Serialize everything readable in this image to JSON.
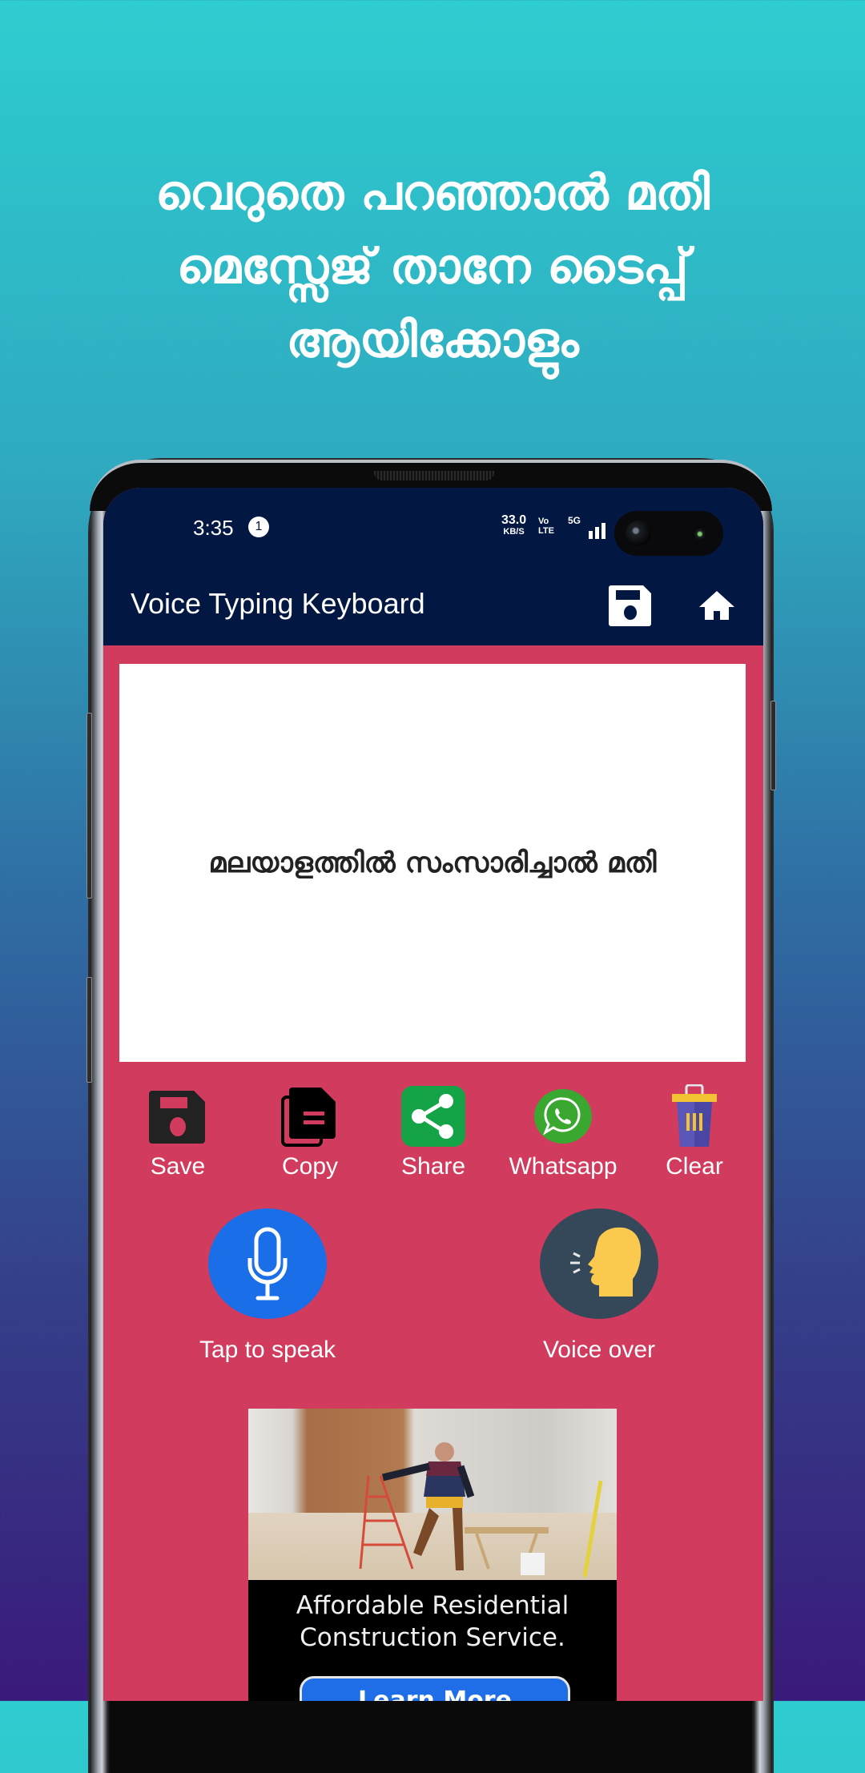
{
  "promo": {
    "lines": [
      "വെറുതെ പറഞ്ഞാൽ മതി",
      "മെസ്സേജ് താനേ ടൈപ്പ്",
      "ആയിക്കോളും"
    ]
  },
  "statusbar": {
    "time": "3:35",
    "notification_count": "1",
    "net_speed_value": "33.0",
    "net_speed_unit": "KB/S",
    "volte_top": "Vo",
    "volte_bottom": "LTE",
    "network_type": "5G",
    "icons": [
      "signal-icon",
      "camera-cutout"
    ]
  },
  "appbar": {
    "title": "Voice Typing Keyboard",
    "actions": [
      {
        "icon": "floppy-disk-icon",
        "label": "save"
      },
      {
        "icon": "home-icon",
        "label": "home"
      }
    ]
  },
  "editor": {
    "text": "മലയാളത്തിൽ സംസാരിച്ചാൽ മതി"
  },
  "actions": [
    {
      "label": "Save",
      "icon": "floppy-disk-icon"
    },
    {
      "label": "Copy",
      "icon": "copy-document-icon"
    },
    {
      "label": "Share",
      "icon": "share-icon"
    },
    {
      "label": "Whatsapp",
      "icon": "whatsapp-icon"
    },
    {
      "label": "Clear",
      "icon": "trash-can-icon"
    }
  ],
  "voice_buttons": [
    {
      "label": "Tap to speak",
      "icon": "microphone-icon",
      "color": "#1a6ee8"
    },
    {
      "label": "Voice over",
      "icon": "speaking-head-icon",
      "color": "#34485a"
    }
  ],
  "ad": {
    "headline_line1": "Affordable Residential",
    "headline_line2": "Construction Service.",
    "cta": "Learn More"
  },
  "colors": {
    "appbar": "#021842",
    "body": "#d13b5e",
    "accent_blue": "#1a6ee8",
    "share_green": "#16a34a",
    "whatsapp_green": "#3aa830"
  }
}
